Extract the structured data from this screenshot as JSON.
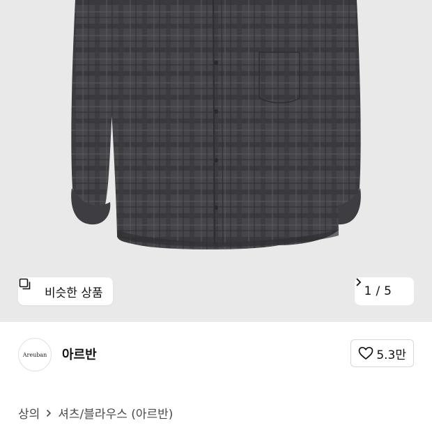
{
  "product_image": {
    "similar_products_label": "비슷한 상품",
    "pager": {
      "current": "1",
      "separator": "/",
      "total": "5"
    }
  },
  "brand": {
    "logo_text": "Areuban",
    "name": "아르반",
    "likes": "5.3만"
  },
  "breadcrumb": {
    "category": "상의",
    "subcategory": "셔츠/블라우스 (아르반)"
  },
  "colors": {
    "image_bg": "#e9e9ea",
    "shirt": "#4a4a4e",
    "shirt_dark": "#37373b",
    "check_line": "#2b2b2f"
  },
  "icons": {
    "similar": "similar-products-icon",
    "pager_next": "chevron-right-icon",
    "like": "heart-outline-icon",
    "breadcrumb_sep": "chevron-right-icon"
  }
}
